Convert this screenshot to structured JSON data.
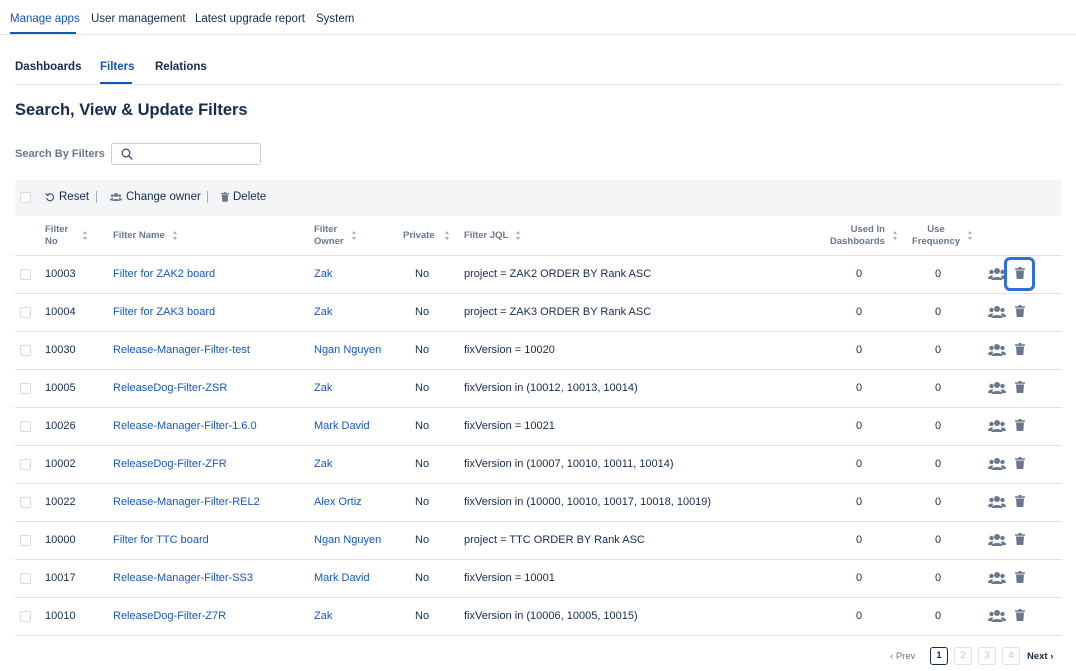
{
  "top_tabs": [
    "Manage apps",
    "User management",
    "Latest upgrade report",
    "System"
  ],
  "sub_tabs": [
    "Dashboards",
    "Filters",
    "Relations"
  ],
  "page_title": "Search, View & Update Filters",
  "search": {
    "label": "Search By Filters",
    "value": "",
    "placeholder": ""
  },
  "toolbar": {
    "reset": "Reset",
    "change_owner": "Change owner",
    "delete": "Delete"
  },
  "columns": {
    "no_l1": "Filter",
    "no_l2": "No",
    "name": "Filter Name",
    "owner_l1": "Filter",
    "owner_l2": "Owner",
    "private": "Private",
    "jql": "Filter JQL",
    "used_l1": "Used In",
    "used_l2": "Dashboards",
    "freq_l1": "Use",
    "freq_l2": "Frequency"
  },
  "rows": [
    {
      "no": "10003",
      "name": "Filter for ZAK2 board",
      "owner": "Zak",
      "private": "No",
      "jql": "project = ZAK2 ORDER BY Rank ASC",
      "used": "0",
      "freq": "0"
    },
    {
      "no": "10004",
      "name": "Filter for ZAK3 board",
      "owner": "Zak",
      "private": "No",
      "jql": "project = ZAK3 ORDER BY Rank ASC",
      "used": "0",
      "freq": "0"
    },
    {
      "no": "10030",
      "name": "Release-Manager-Filter-test",
      "owner": "Ngan Nguyen",
      "private": "No",
      "jql": "fixVersion = 10020",
      "used": "0",
      "freq": "0"
    },
    {
      "no": "10005",
      "name": "ReleaseDog-Filter-ZSR",
      "owner": "Zak",
      "private": "No",
      "jql": "fixVersion in (10012, 10013, 10014)",
      "used": "0",
      "freq": "0"
    },
    {
      "no": "10026",
      "name": "Release-Manager-Filter-1.6.0",
      "owner": "Mark David",
      "private": "No",
      "jql": "fixVersion = 10021",
      "used": "0",
      "freq": "0"
    },
    {
      "no": "10002",
      "name": "ReleaseDog-Filter-ZFR",
      "owner": "Zak",
      "private": "No",
      "jql": "fixVersion in (10007, 10010, 10011, 10014)",
      "used": "0",
      "freq": "0"
    },
    {
      "no": "10022",
      "name": "Release-Manager-Filter-REL2",
      "owner": "Alex Ortiz",
      "private": "No",
      "jql": "fixVersion in (10000, 10010, 10017, 10018, 10019)",
      "used": "0",
      "freq": "0"
    },
    {
      "no": "10000",
      "name": "Filter for TTC board",
      "owner": "Ngan Nguyen",
      "private": "No",
      "jql": "project = TTC ORDER BY Rank ASC",
      "used": "0",
      "freq": "0"
    },
    {
      "no": "10017",
      "name": "Release-Manager-Filter-SS3",
      "owner": "Mark David",
      "private": "No",
      "jql": "fixVersion = 10001",
      "used": "0",
      "freq": "0"
    },
    {
      "no": "10010",
      "name": "ReleaseDog-Filter-Z7R",
      "owner": "Zak",
      "private": "No",
      "jql": "fixVersion in (10006, 10005, 10015)",
      "used": "0",
      "freq": "0"
    }
  ],
  "pagination": {
    "prev": "Prev",
    "next": "Next",
    "pages": [
      "1",
      "2",
      "3",
      "4"
    ],
    "current": "1"
  },
  "colors": {
    "accent": "#1558bc",
    "highlight": "#2e6fd9",
    "text": "#172b4d",
    "muted": "#6b778c"
  },
  "icons": {
    "reset": "undo-icon",
    "change_owner": "users-icon",
    "delete": "trash-icon",
    "search": "search-icon"
  }
}
